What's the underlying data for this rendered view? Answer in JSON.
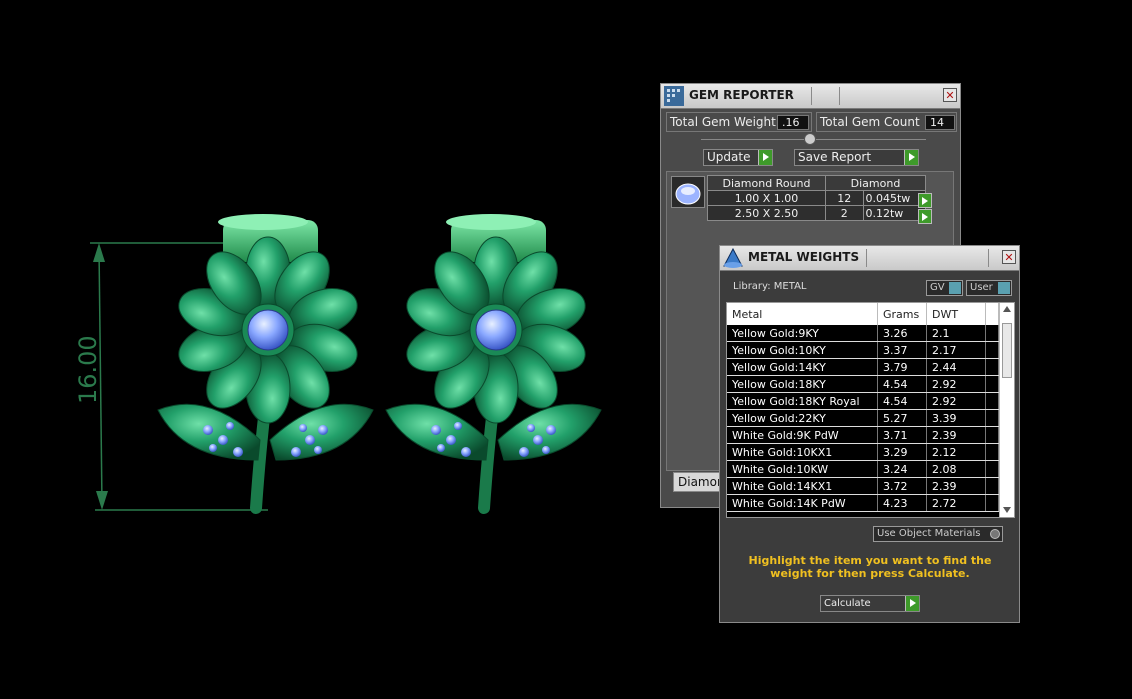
{
  "viewport": {
    "dimension_label": "16.00"
  },
  "gem_reporter": {
    "title": "GEM REPORTER",
    "total_gem_weight_label": "Total Gem Weight",
    "total_gem_weight_value": ".16",
    "total_gem_count_label": "Total Gem Count",
    "total_gem_count_value": "14",
    "update_label": "Update",
    "save_report_label": "Save Report",
    "table_headers": [
      "Diamond Round",
      "Diamond"
    ],
    "rows": [
      {
        "size": "1.00 X 1.00",
        "count": "12",
        "weight": "0.045tw"
      },
      {
        "size": "2.50 X 2.50",
        "count": "2",
        "weight": "0.12tw"
      }
    ],
    "bottom_button_label": "Diamond"
  },
  "metal_weights": {
    "title": "METAL WEIGHTS",
    "library_label": "Library: METAL",
    "gv_label": "GV",
    "user_label": "User",
    "columns": [
      "Metal",
      "Grams",
      "DWT"
    ],
    "rows": [
      {
        "metal": "Yellow Gold:9KY",
        "grams": "3.26",
        "dwt": "2.1"
      },
      {
        "metal": "Yellow Gold:10KY",
        "grams": "3.37",
        "dwt": "2.17"
      },
      {
        "metal": "Yellow Gold:14KY",
        "grams": "3.79",
        "dwt": "2.44"
      },
      {
        "metal": "Yellow Gold:18KY",
        "grams": "4.54",
        "dwt": "2.92"
      },
      {
        "metal": "Yellow Gold:18KY Royal",
        "grams": "4.54",
        "dwt": "2.92"
      },
      {
        "metal": "Yellow Gold:22KY",
        "grams": "5.27",
        "dwt": "3.39"
      },
      {
        "metal": "White Gold:9K PdW",
        "grams": "3.71",
        "dwt": "2.39"
      },
      {
        "metal": "White Gold:10KX1",
        "grams": "3.29",
        "dwt": "2.12"
      },
      {
        "metal": "White Gold:10KW",
        "grams": "3.24",
        "dwt": "2.08"
      },
      {
        "metal": "White Gold:14KX1",
        "grams": "3.72",
        "dwt": "2.39"
      },
      {
        "metal": "White Gold:14K PdW",
        "grams": "4.23",
        "dwt": "2.72"
      }
    ],
    "use_object_materials_label": "Use Object Materials",
    "instruction": "Highlight the item you want to find the weight for then press Calculate.",
    "calculate_label": "Calculate"
  },
  "colors": {
    "earring_green": "#1f8a5a",
    "gem_blue": "#8aa8ff",
    "dimension_green": "#2b7a4c",
    "instruction_yellow": "#f0c020",
    "button_green": "#3e9a2a"
  }
}
